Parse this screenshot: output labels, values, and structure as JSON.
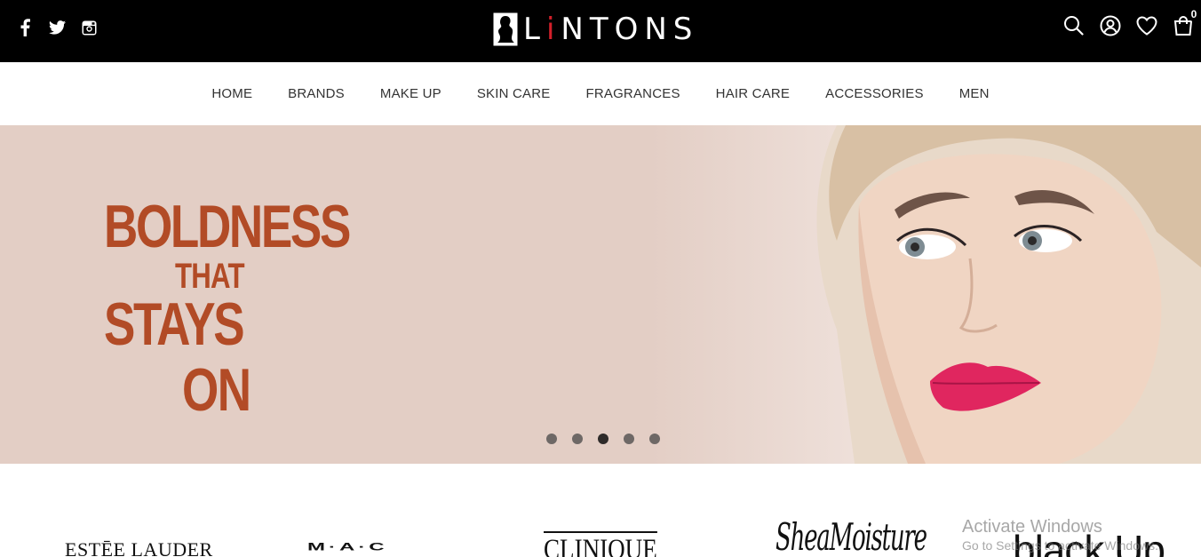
{
  "brand": {
    "logo_text_prefix": "L",
    "logo_text_i": "i",
    "logo_text_suffix": "NTONS",
    "accent_color": "#d4202a"
  },
  "social": {
    "icons": [
      "facebook-icon",
      "twitter-icon",
      "instagram-icon"
    ]
  },
  "utilities": {
    "icons": [
      "search-icon",
      "account-icon",
      "wishlist-heart-icon",
      "cart-icon"
    ],
    "cart_count": "0"
  },
  "nav": {
    "items": [
      {
        "label": "HOME"
      },
      {
        "label": "BRANDS"
      },
      {
        "label": "MAKE UP"
      },
      {
        "label": "SKIN CARE"
      },
      {
        "label": "FRAGRANCES"
      },
      {
        "label": "HAIR CARE"
      },
      {
        "label": "ACCESSORIES"
      },
      {
        "label": "MEN"
      }
    ]
  },
  "hero": {
    "headline_line1": "BOLDNESS",
    "headline_line2": "THAT",
    "headline_line3": "STAYS",
    "headline_line4": "ON",
    "headline_color": "#b24b26",
    "background_color": "#e3cec5",
    "slide_count": 5,
    "active_slide": 3
  },
  "brands_strip": {
    "brands": [
      {
        "name": "ESTĒE LAUDER"
      },
      {
        "name": "M·A·C"
      },
      {
        "name": "CLINIQUE"
      },
      {
        "name": "SheaMoisture"
      },
      {
        "name": "black Up"
      }
    ]
  },
  "os_watermark": {
    "line1": "Activate Windows",
    "line2": "Go to Settings to activate Windows."
  }
}
